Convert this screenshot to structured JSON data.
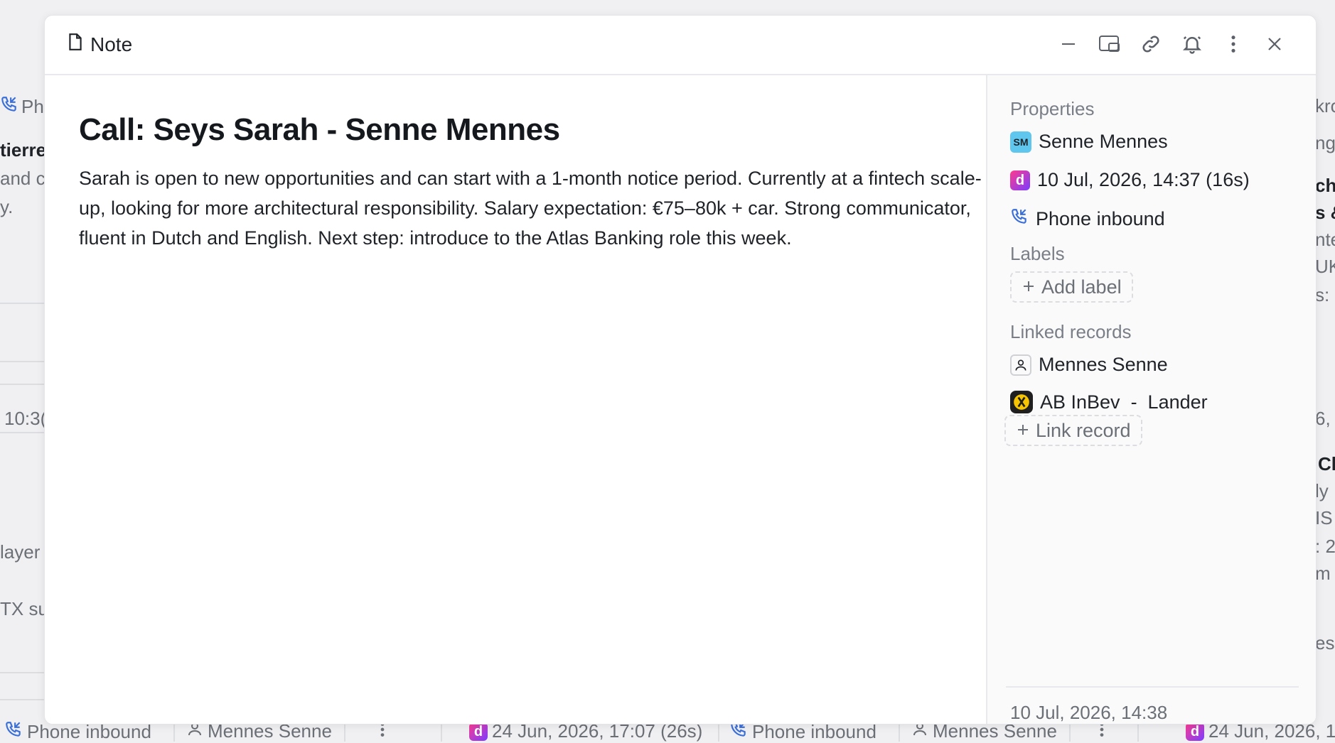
{
  "background": {
    "left_texts": [
      "Ph",
      "tierre:",
      "and c",
      "y.",
      "10:3(",
      "layer",
      "TX su"
    ],
    "right_texts": [
      "kro",
      "ng",
      "ch",
      "s &",
      "nte",
      "UK",
      "s: (",
      "6, ",
      "Cl",
      "ly",
      "IS",
      ": 2",
      "m",
      "es"
    ],
    "bottom_bar": [
      {
        "icon": "phone-inbound-icon",
        "label": "Phone inbound"
      },
      {
        "icon": "person-icon",
        "label": "Mennes Senne"
      },
      {
        "icon": "meeting-icon",
        "label": "24 Jun, 2026, 17:07 (26s)"
      },
      {
        "icon": "phone-inbound-icon",
        "label": "Phone inbound"
      },
      {
        "icon": "person-icon",
        "label": "Mennes Senne"
      },
      {
        "icon": "meeting-icon",
        "label": "24 Jun, 2026, 1"
      }
    ]
  },
  "modal": {
    "header": {
      "title": "Note",
      "icons": [
        "minimize-icon",
        "open-in-panel-icon",
        "link-icon",
        "bell-icon",
        "more-vertical-icon",
        "close-icon"
      ]
    },
    "note": {
      "title": "Call: Seys Sarah - Senne Mennes",
      "body": "Sarah is open to new opportunities and can start with a 1-month notice period. Currently at a fintech scale-up, looking for more architectural responsibility. Salary expectation: €75–80k + car. Strong communicator, fluent in Dutch and English. Next step: introduce to the Atlas Banking role this week."
    },
    "sidebar": {
      "properties_label": "Properties",
      "owner_initials": "SM",
      "owner_name": "Senne Mennes",
      "meeting_datetime": "10 Jul, 2026, 14:37 (16s)",
      "call_type": "Phone inbound",
      "labels_label": "Labels",
      "add_label": "Add label",
      "linked_records_label": "Linked records",
      "linked_records": [
        {
          "icon": "person-icon",
          "label": "Mennes Senne"
        },
        {
          "icon": "company-logo-icon",
          "label": "AB InBev  -  Lander"
        }
      ],
      "link_record": "Link record",
      "created_at": "10 Jul, 2026, 14:38"
    }
  },
  "colors": {
    "accent_blue": "#3b6fd8",
    "meeting_gradient": "#ff3c8e",
    "avatar_bg": "#5fc6ee"
  }
}
